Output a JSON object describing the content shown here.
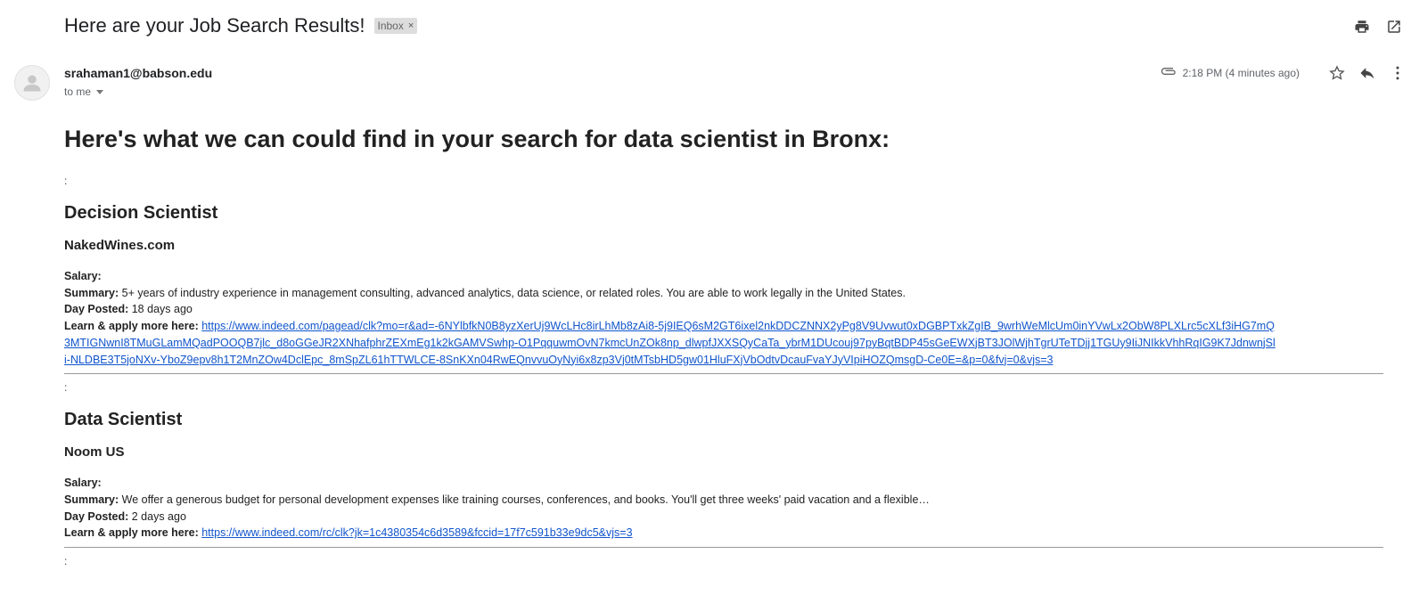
{
  "email": {
    "subject": "Here are your Job Search Results!",
    "label": "Inbox",
    "sender": "srahaman1@babson.edu",
    "recipient": "to me",
    "timestamp": "2:18 PM (4 minutes ago)",
    "heading": "Here's what we can could find in your search for data scientist in Bronx:"
  },
  "icons": {
    "print": "print-icon",
    "open_new_window": "open-in-new-window-icon",
    "attachment": "attachment-icon",
    "star": "star-icon",
    "reply": "reply-icon",
    "more": "more-vertical-icon"
  },
  "labels": {
    "salary": "Salary:",
    "summary": "Summary:",
    "day_posted": "Day Posted:",
    "learn_apply": "Learn & apply more here:",
    "separator": ":"
  },
  "jobs": [
    {
      "title": "Decision Scientist",
      "company": "NakedWines.com",
      "salary": "",
      "summary": "5+ years of industry experience in management consulting, advanced analytics, data science, or related roles. You are able to work legally in the United States.",
      "day_posted": "18 days ago",
      "link": "https://www.indeed.com/pagead/clk?mo=r&ad=-6NYlbfkN0B8yzXerUj9WcLHc8irLhMb8zAi8-5j9IEQ6sM2GT6ixel2nkDDCZNNX2yPg8V9Uvwut0xDGBPTxkZgIB_9wrhWeMlcUm0inYVwLx2ObW8PLXLrc5cXLf3iHG7mQ3MTIGNwnI8TMuGLamMQadPOOQB7jlc_d8oGGeJR2XNhafphrZEXmEg1k2kGAMVSwhp-O1PqquwmOvN7kmcUnZOk8np_dlwpfJXXSQyCaTa_ybrM1DUcouj97pyBqtBDP45sGeEWXjBT3JOlWjhTgrUTeTDjj1TGUy9IiJNIkkVhhRqIG9K7JdnwnjSli-NLDBE3T5joNXv-YboZ9epv8h1T2MnZOw4DclEpc_8mSpZL61hTTWLCE-8SnKXn04RwEQnvvuOyNyi6x8zp3Vj0tMTsbHD5gw01HluFXjVbOdtvDcauFvaYJyVIpiHOZQmsgD-Ce0E=&p=0&fvj=0&vjs=3"
    },
    {
      "title": "Data Scientist",
      "company": "Noom US",
      "salary": "",
      "summary": "We offer a generous budget for personal development expenses like training courses, conferences, and books. You'll get three weeks' paid vacation and a flexible…",
      "day_posted": "2 days ago",
      "link": "https://www.indeed.com/rc/clk?jk=1c4380354c6d3589&fccid=17f7c591b33e9dc5&vjs=3"
    }
  ]
}
